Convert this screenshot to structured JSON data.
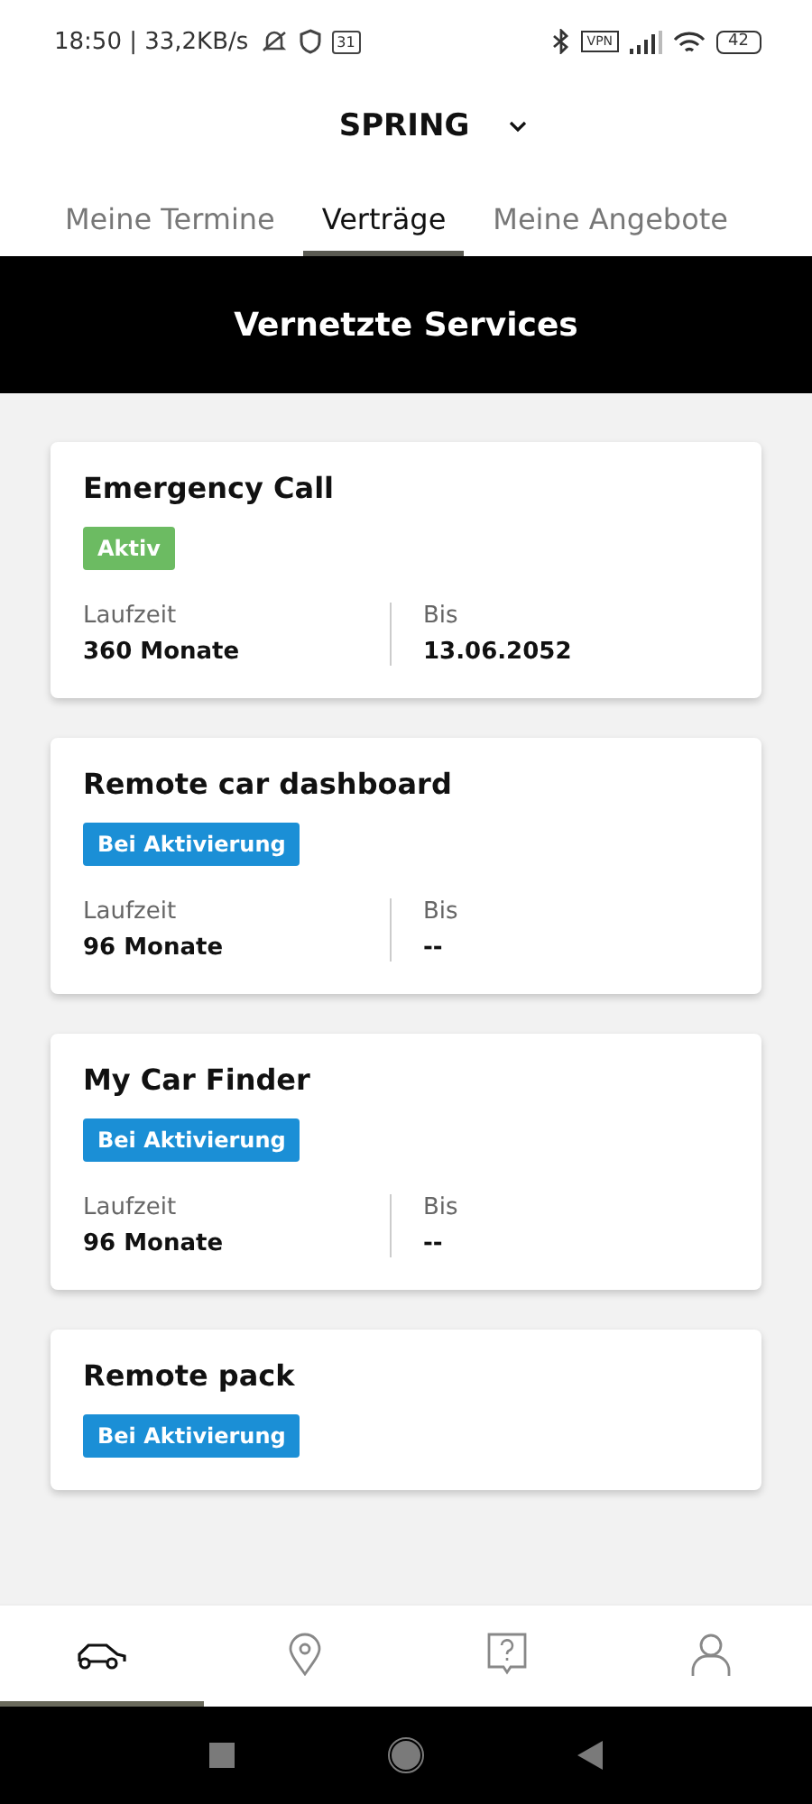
{
  "status_bar": {
    "time": "18:50 | 33,2KB/s",
    "calendar": "31",
    "vpn": "VPN",
    "battery": "42"
  },
  "header": {
    "title": "SPRING"
  },
  "tabs": [
    {
      "label": "Meine Termine",
      "selected": false
    },
    {
      "label": "Verträge",
      "selected": true
    },
    {
      "label": "Meine Angebote",
      "selected": false
    }
  ],
  "banner": {
    "title": "Vernetzte Services"
  },
  "services": [
    {
      "name": "Emergency Call",
      "status": "Aktiv",
      "kind": "active",
      "duration_label": "Laufzeit",
      "duration": "360 Monate",
      "until_label": "Bis",
      "until": "13.06.2052"
    },
    {
      "name": "Remote car dashboard",
      "status": "Bei Aktivierung",
      "kind": "pending",
      "duration_label": "Laufzeit",
      "duration": "96 Monate",
      "until_label": "Bis",
      "until": "--"
    },
    {
      "name": "My Car Finder",
      "status": "Bei Aktivierung",
      "kind": "pending",
      "duration_label": "Laufzeit",
      "duration": "96 Monate",
      "until_label": "Bis",
      "until": "--"
    },
    {
      "name": "Remote pack",
      "status": "Bei Aktivierung",
      "kind": "pending"
    }
  ],
  "bottom_nav": [
    {
      "kind": "car",
      "selected": true
    },
    {
      "kind": "pin",
      "selected": false
    },
    {
      "kind": "help",
      "selected": false
    },
    {
      "kind": "user",
      "selected": false
    }
  ]
}
